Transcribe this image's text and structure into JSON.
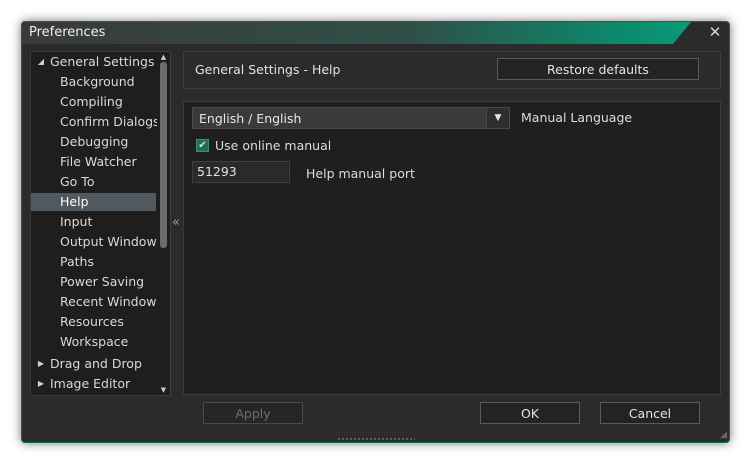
{
  "window": {
    "title": "Preferences",
    "close_glyph": "✕"
  },
  "tree": {
    "items": [
      {
        "label": "General Settings",
        "level": 0,
        "expanded": true,
        "selected": false
      },
      {
        "label": "Background",
        "level": 1,
        "selected": false
      },
      {
        "label": "Compiling",
        "level": 1,
        "selected": false
      },
      {
        "label": "Confirm Dialogs",
        "level": 1,
        "selected": false
      },
      {
        "label": "Debugging",
        "level": 1,
        "selected": false
      },
      {
        "label": "File Watcher",
        "level": 1,
        "selected": false
      },
      {
        "label": "Go To",
        "level": 1,
        "selected": false
      },
      {
        "label": "Help",
        "level": 1,
        "selected": true
      },
      {
        "label": "Input",
        "level": 1,
        "selected": false
      },
      {
        "label": "Output Windows",
        "level": 1,
        "selected": false
      },
      {
        "label": "Paths",
        "level": 1,
        "selected": false
      },
      {
        "label": "Power Saving",
        "level": 1,
        "selected": false
      },
      {
        "label": "Recent Windows",
        "level": 1,
        "selected": false
      },
      {
        "label": "Resources",
        "level": 1,
        "selected": false
      },
      {
        "label": "Workspace",
        "level": 1,
        "selected": false
      },
      {
        "label": "Drag and Drop",
        "level": 0,
        "expanded": false,
        "selected": false
      },
      {
        "label": "Image Editor",
        "level": 0,
        "expanded": false,
        "selected": false
      }
    ]
  },
  "collapse_handle": "«",
  "header": {
    "title": "General Settings - Help",
    "restore_label": "Restore defaults"
  },
  "help": {
    "language_value": "English / English",
    "language_label": "Manual Language",
    "online_checked": true,
    "online_label": "Use online manual",
    "port_value": "51293",
    "port_label": "Help manual port"
  },
  "footer": {
    "apply_label": "Apply",
    "ok_label": "OK",
    "cancel_label": "Cancel"
  },
  "colors": {
    "accent": "#0aa27c",
    "selection": "#505860",
    "checkbox": "#2a6b58"
  }
}
